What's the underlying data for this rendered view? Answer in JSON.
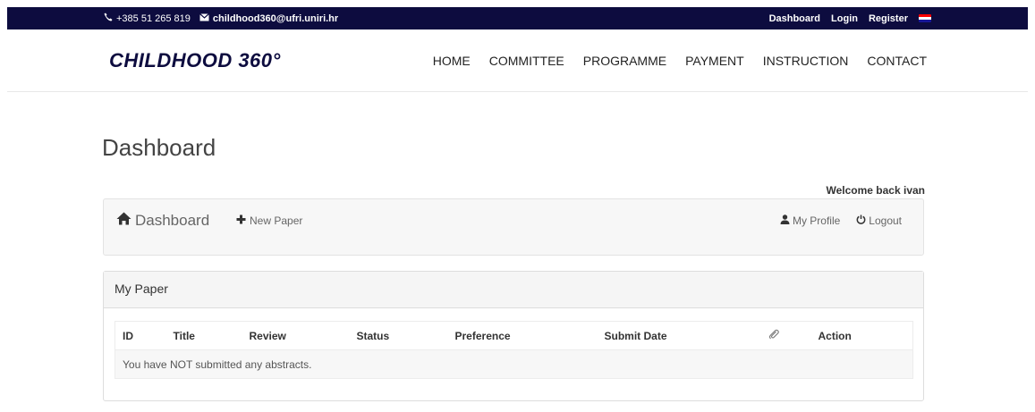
{
  "topbar": {
    "phone": "+385 51 265 819",
    "email": "childhood360@ufri.uniri.hr",
    "links": [
      "Dashboard",
      "Login",
      "Register"
    ],
    "flag_colors": [
      "#ff0000",
      "#ffffff",
      "#171796"
    ]
  },
  "header": {
    "logo": "CHILDHOOD 360°",
    "nav": [
      "HOME",
      "COMMITTEE",
      "PROGRAMME",
      "PAYMENT",
      "INSTRUCTION",
      "CONTACT"
    ]
  },
  "page": {
    "title": "Dashboard",
    "welcome": "Welcome back ivan"
  },
  "toolbar": {
    "brand": "Dashboard",
    "new_paper": "New Paper",
    "my_profile": "My Profile",
    "logout": "Logout"
  },
  "panel": {
    "heading": "My Paper",
    "columns": [
      "ID",
      "Title",
      "Review",
      "Status",
      "Preference",
      "Submit Date",
      "Action"
    ],
    "empty_message": "You have NOT submitted any abstracts."
  },
  "colors": {
    "topbar_bg": "#0d0c3f",
    "logo": "#0d0c3f"
  }
}
